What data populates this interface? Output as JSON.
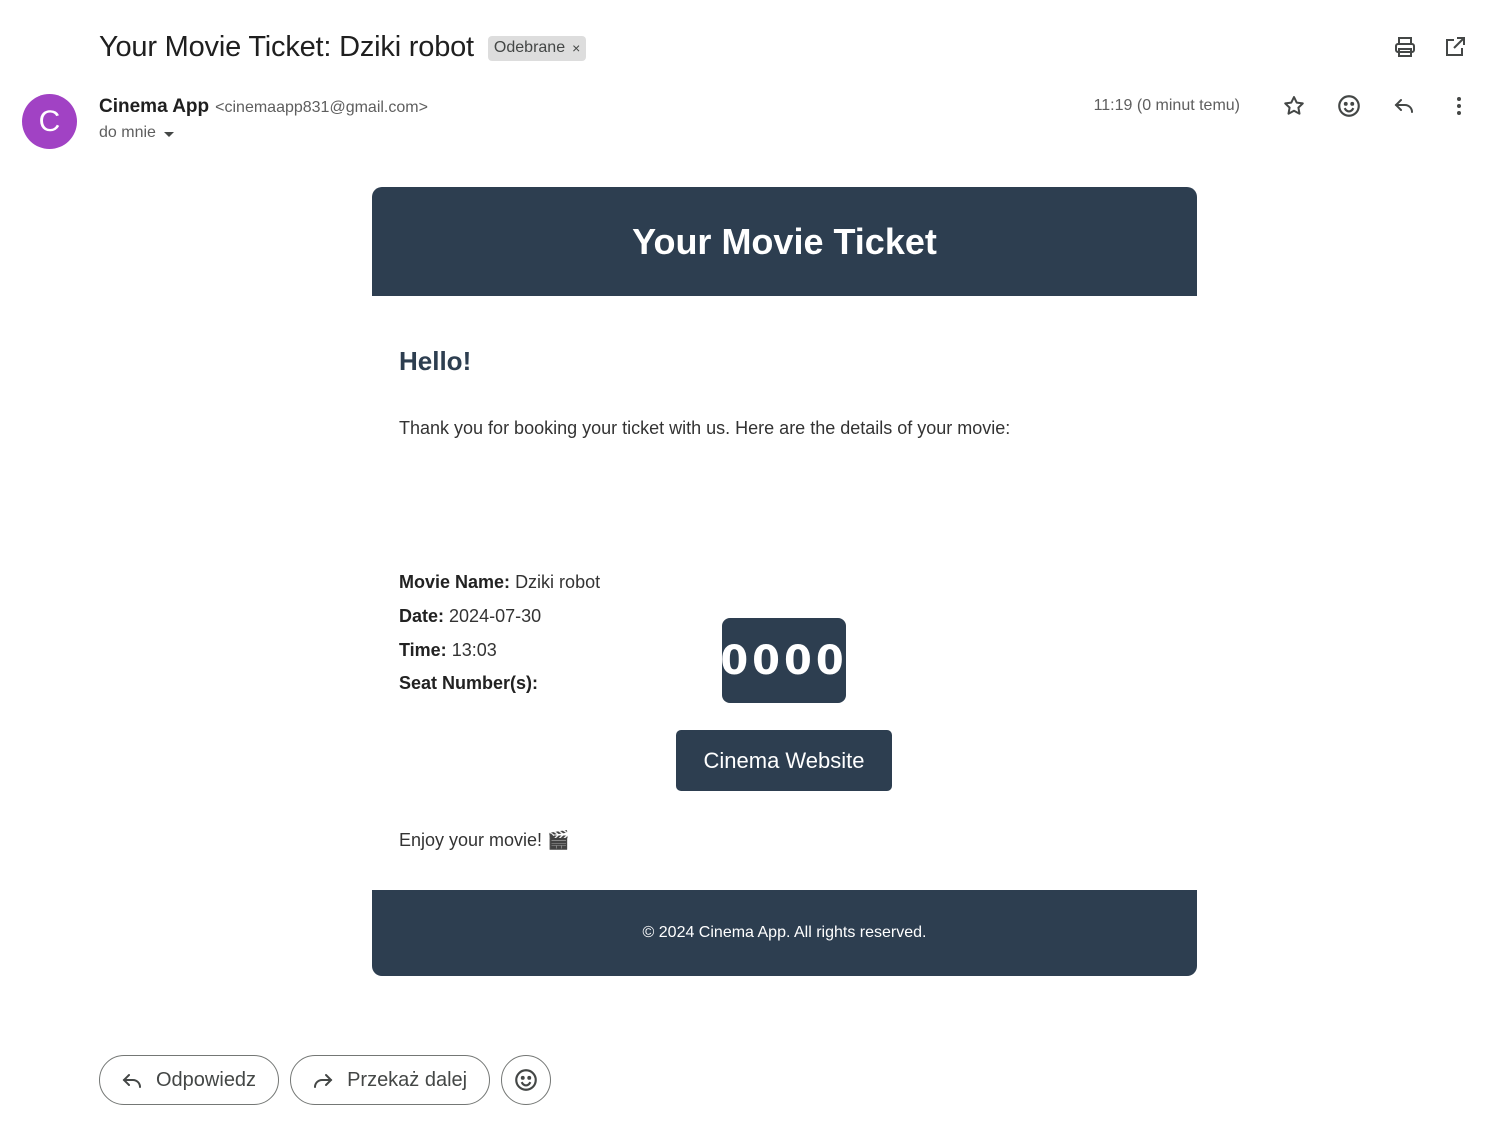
{
  "email": {
    "subject": "Your Movie Ticket: Dziki robot",
    "label": "Odebrane",
    "label_remove": "×",
    "sender": {
      "initial": "C",
      "name": "Cinema App",
      "email": "<cinemaapp831@gmail.com>",
      "to": "do mnie"
    },
    "timestamp": "11:19 (0 minut temu)",
    "avatar_color": "#a142c4"
  },
  "top_icons": [
    "print-icon",
    "open-in-new-window-icon"
  ],
  "meta_icons": [
    "star-icon",
    "emoji-reaction-icon",
    "reply-icon",
    "more-vert-icon"
  ],
  "ticket": {
    "header_title": "Your Movie Ticket",
    "greeting": "Hello!",
    "intro": "Thank you for booking your ticket with us. Here are the details of your movie:",
    "movie_label": "Movie Name:",
    "movie_value": "Dziki robot",
    "date_label": "Date:",
    "date_value": "2024-07-30",
    "time_label": "Time:",
    "time_value": "13:03",
    "seat_label": "Seat Number(s):",
    "seat_value": "0000",
    "website_button": "Cinema Website",
    "enjoy": "Enjoy your movie! 🎬",
    "footer": "© 2024 Cinema App. All rights reserved.",
    "theme_color": "#2d3e50"
  },
  "actions": {
    "reply": "Odpowiedz",
    "forward": "Przekaż dalej"
  }
}
